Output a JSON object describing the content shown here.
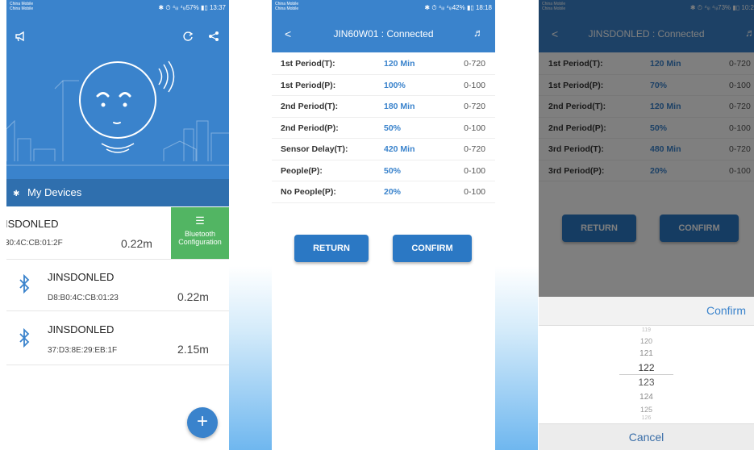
{
  "colors": {
    "primary": "#3a83cc",
    "dark_blue": "#2f6fae",
    "green": "#52b563",
    "button": "#2b78c4"
  },
  "phone1": {
    "statusbar": {
      "carrier_line1": "China Mobile",
      "carrier_line2": "China Mobile",
      "right": "✱ ⏱ ⁴ₗᵢₗ ⁴ₗᵢₗ57% ▮▯ 13:37"
    },
    "top_icons": [
      "megaphone-icon",
      "refresh-icon",
      "share-icon"
    ],
    "my_devices_label": "My Devices",
    "swiped_device": {
      "name": "ISDONLED",
      "mac": "30:4C:CB:01:2F",
      "distance": "0.22m"
    },
    "bluetooth_config": {
      "line1": "Bluetooth",
      "line2": "Configuration"
    },
    "devices": [
      {
        "name": "JINSDONLED",
        "mac": "D8:B0:4C:CB:01:23",
        "distance": "0.22m"
      },
      {
        "name": "JINSDONLED",
        "mac": "37:D3:8E:29:EB:1F",
        "distance": "2.15m"
      }
    ],
    "fab_label": "+"
  },
  "phone2": {
    "statusbar": {
      "carrier_line1": "China Mobile",
      "carrier_line2": "China Mobile",
      "right": "✱ ⏱ ⁴ₗᵢₗ ⁴ₗᵢₗ42% ▮▯ 18:18"
    },
    "back": "<",
    "title": "JIN60W01 : Connected",
    "note": "♬",
    "params": [
      {
        "label": "1st Period(T):",
        "value": "120 Min",
        "range": "0-720"
      },
      {
        "label": "1st Period(P):",
        "value": "100%",
        "range": "0-100"
      },
      {
        "label": "2nd Period(T):",
        "value": "180 Min",
        "range": "0-720"
      },
      {
        "label": "2nd Period(P):",
        "value": "50%",
        "range": "0-100"
      },
      {
        "label": "Sensor Delay(T):",
        "value": "420 Min",
        "range": "0-720"
      },
      {
        "label": "People(P):",
        "value": "50%",
        "range": "0-100"
      },
      {
        "label": "No People(P):",
        "value": "20%",
        "range": "0-100"
      }
    ],
    "return_label": "RETURN",
    "confirm_label": "CONFIRM"
  },
  "phone3": {
    "statusbar": {
      "carrier_line1": "China Mobile",
      "carrier_line2": "China Mobile",
      "right": "✱ ⏱ ⁴ₗᵢₗ ⁴ₗᵢₗ73% ▮▯ 10:2"
    },
    "back": "<",
    "title": "JINSDONLED : Connected",
    "note": "♬",
    "params": [
      {
        "label": "1st Period(T):",
        "value": "120 Min",
        "range": "0-720"
      },
      {
        "label": "1st Period(P):",
        "value": "70%",
        "range": "0-100"
      },
      {
        "label": "2nd Period(T):",
        "value": "120 Min",
        "range": "0-720"
      },
      {
        "label": "2nd Period(P):",
        "value": "50%",
        "range": "0-100"
      },
      {
        "label": "3rd Period(T):",
        "value": "480 Min",
        "range": "0-720"
      },
      {
        "label": "3rd Period(P):",
        "value": "20%",
        "range": "0-100"
      }
    ],
    "return_label": "RETURN",
    "confirm_label": "CONFIRM",
    "sheet_confirm": "Confirm",
    "picker_items": [
      "119",
      "120",
      "121",
      "122",
      "123",
      "124",
      "125",
      "126"
    ],
    "picker_selected": "122",
    "cancel_label": "Cancel"
  }
}
